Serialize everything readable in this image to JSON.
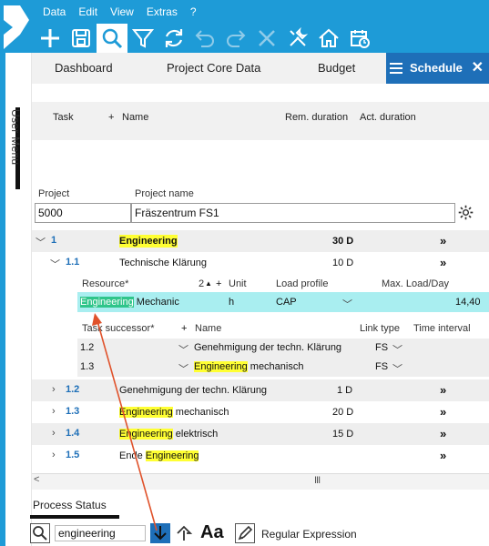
{
  "menu": {
    "items": [
      "Data",
      "Edit",
      "View",
      "Extras",
      "?"
    ]
  },
  "toolbar": {
    "icons": [
      "add-icon",
      "save-icon",
      "search-icon",
      "filter-icon",
      "refresh-icon",
      "undo-icon",
      "redo-icon",
      "delete-icon",
      "tools-icon",
      "home-icon",
      "calendar-icon"
    ]
  },
  "rail": {
    "label": "User Menu"
  },
  "tabs": {
    "dashboard": "Dashboard",
    "core": "Project Core Data",
    "budget": "Budget",
    "schedule": "Schedule",
    "close": "✕"
  },
  "grid_header": {
    "task": "Task",
    "plus": "+",
    "name": "Name",
    "rem": "Rem. duration",
    "act": "Act. duration"
  },
  "project": {
    "project_label": "Project",
    "name_label": "Project name",
    "project_value": "5000",
    "name_value": "Fräszentrum FS1"
  },
  "tasks": {
    "t1": {
      "num": "1",
      "name": "Engineering",
      "dur": "30 D"
    },
    "t11": {
      "num": "1.1",
      "name": "Technische Klärung",
      "dur": "10 D"
    },
    "t12": {
      "num": "1.2",
      "name": "Genehmigung der techn. Klärung",
      "dur": "1 D"
    },
    "t13": {
      "num": "1.3",
      "name_hl": "Engineering",
      "name_rest": " mechanisch",
      "dur": "20 D"
    },
    "t14": {
      "num": "1.4",
      "name_hl": "Engineering",
      "name_rest": " elektrisch",
      "dur": "15 D"
    },
    "t15": {
      "num": "1.5",
      "name_pre": "Ende ",
      "name_hl": "Engineering"
    }
  },
  "resource": {
    "h_resource": "Resource*",
    "h_sort": "2",
    "h_plus": "+",
    "h_unit": "Unit",
    "h_profile": "Load profile",
    "h_max": "Max. Load/Day",
    "r_hl": "Engineering",
    "r_rest": " Mechanic",
    "r_unit": "h",
    "r_profile": "CAP",
    "r_max": "14,40"
  },
  "successors": {
    "h_task": "Task successor*",
    "h_plus": "+",
    "h_name": "Name",
    "h_link": "Link type",
    "h_interval": "Time interval",
    "s1": {
      "num": "1.2",
      "name": "Genehmigung der techn. Klärung",
      "link": "FS"
    },
    "s2": {
      "num": "1.3",
      "name_hl": "Engineering",
      "name_rest": " mechanisch",
      "link": "FS"
    }
  },
  "dbl_glyph": "»",
  "scrollbar": {
    "left": "<",
    "mid": "III"
  },
  "bottom": {
    "process_status": "Process Status",
    "search_value": "engineering",
    "aa": "Aa",
    "regex": "Regular Expression"
  },
  "colors": {
    "brand": "#1e9bd7",
    "tab_active": "#1e6fb8",
    "highlight": "#ffff33",
    "resource_row": "#a9eef0",
    "green_hit": "#2fc58a",
    "arrow": "#e0522b"
  }
}
